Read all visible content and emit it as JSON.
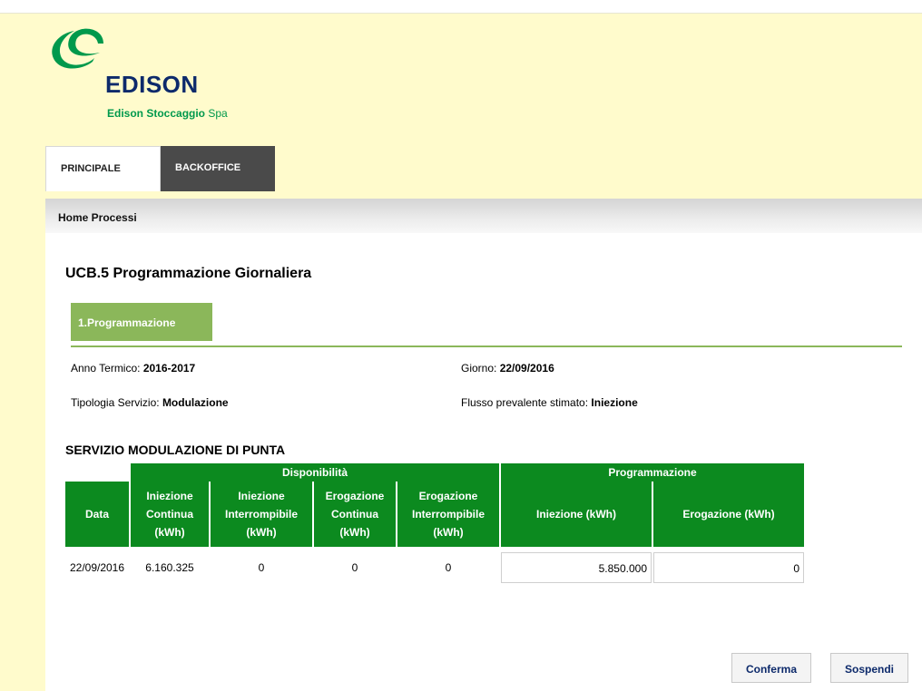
{
  "brand": {
    "name": "EDISON",
    "subtitle_bold": "Edison Stoccaggio",
    "subtitle_rest": "Spa"
  },
  "tabs": [
    {
      "label": "PRINCIPALE"
    },
    {
      "label": "BACKOFFICE"
    }
  ],
  "breadcrumb": "Home Processi",
  "page_title": "UCB.5 Programmazione Giornaliera",
  "steps": [
    {
      "label": "1.Programmazione"
    }
  ],
  "info": {
    "anno_termico_label": "Anno Termico: ",
    "anno_termico_value": "2016-2017",
    "giorno_label": "Giorno: ",
    "giorno_value": "22/09/2016",
    "tipologia_label": "Tipologia Servizio: ",
    "tipologia_value": "Modulazione",
    "flusso_label": "Flusso prevalente stimato: ",
    "flusso_value": "Iniezione"
  },
  "section_title": "SERVIZIO MODULAZIONE DI PUNTA",
  "table": {
    "group_headers": {
      "disponibilita": "Disponibilità",
      "programmazione": "Programmazione"
    },
    "columns": {
      "data": "Data",
      "iniezione_continua": [
        "Iniezione",
        "Continua",
        "(kWh)"
      ],
      "iniezione_interrompibile": [
        "Iniezione",
        "Interrompibile",
        "(kWh)"
      ],
      "erogazione_continua": [
        "Erogazione",
        "Continua",
        "(kWh)"
      ],
      "erogazione_interrompibile": [
        "Erogazione",
        "Interrompibile",
        "(kWh)"
      ],
      "iniezione_kwh": "Iniezione (kWh)",
      "erogazione_kwh": "Erogazione (kWh)"
    },
    "row": {
      "data": "22/09/2016",
      "iniezione_continua": "6.160.325",
      "iniezione_interrompibile": "0",
      "erogazione_continua": "0",
      "erogazione_interrompibile": "0",
      "iniezione_kwh": "5.850.000",
      "erogazione_kwh": "0"
    }
  },
  "buttons": {
    "confirm": "Conferma",
    "suspend": "Sospendi"
  },
  "colors": {
    "header_bg": "#fffbcc",
    "table_green": "#0c8a1f",
    "step_green": "#8bb75a",
    "brand_blue": "#0d2a6b",
    "brand_green": "#00994c"
  }
}
